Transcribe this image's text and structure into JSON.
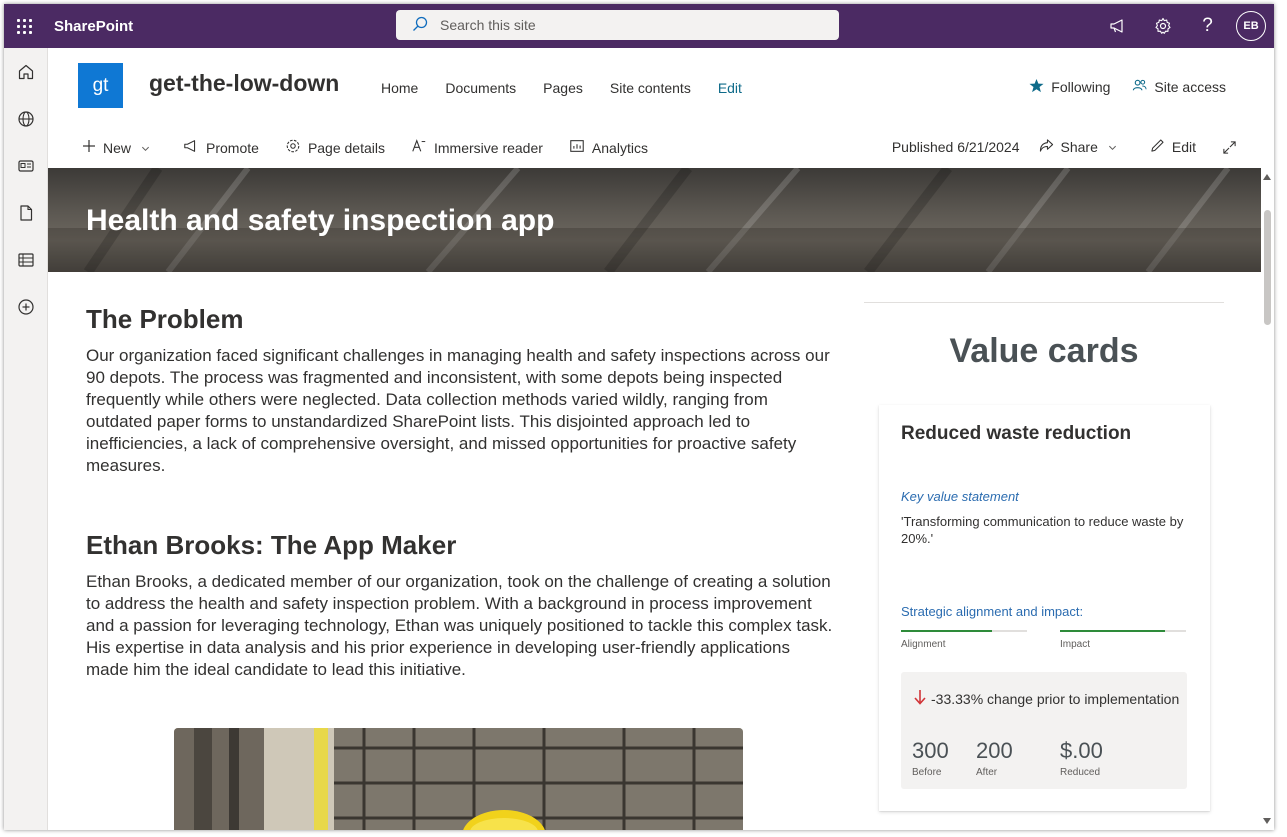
{
  "suitebar": {
    "brand": "SharePoint",
    "search_placeholder": "Search this site",
    "avatar_initials": "EB"
  },
  "site": {
    "logo_text": "gt",
    "title": "get-the-low-down",
    "nav": [
      "Home",
      "Documents",
      "Pages",
      "Site contents",
      "Edit"
    ],
    "following_label": "Following",
    "site_access_label": "Site access"
  },
  "commandbar": {
    "new_label": "New",
    "promote_label": "Promote",
    "page_details_label": "Page details",
    "immersive_reader_label": "Immersive reader",
    "analytics_label": "Analytics",
    "published_text": "Published 6/21/2024",
    "share_label": "Share",
    "edit_label": "Edit"
  },
  "banner": {
    "title": "Health and safety inspection app"
  },
  "content": {
    "section1_heading": "The Problem",
    "section1_text": "Our organization faced significant challenges in managing health and safety inspections across our 90 depots. The process was fragmented and inconsistent, with some depots being inspected frequently while others were neglected. Data collection methods varied wildly, ranging from outdated paper forms to unstandardized SharePoint lists. This disjointed approach led to inefficiencies, a lack of comprehensive oversight, and missed opportunities for proactive safety measures.",
    "section2_heading": "Ethan Brooks: The App Maker",
    "section2_text": "Ethan Brooks, a dedicated member of our organization, took on the challenge of creating a solution to address the health and safety inspection problem. With a background in process improvement and a passion for leveraging technology, Ethan was uniquely positioned to tackle this complex task. His expertise in data analysis and his prior experience in developing user-friendly applications made him the ideal candidate to lead this initiative."
  },
  "value_cards": {
    "heading": "Value cards",
    "card": {
      "title": "Reduced waste reduction",
      "key_value_label": "Key value statement",
      "key_value_text": "'Transforming communication to reduce waste by 20%.'",
      "strategic_label": "Strategic alignment and impact:",
      "alignment_label": "Alignment",
      "alignment_level": 0.72,
      "impact_label": "Impact",
      "impact_level": 0.83,
      "change_text": "-33.33% change prior to implementation",
      "before_value": "300",
      "before_label": "Before",
      "after_value": "200",
      "after_label": "After",
      "reduced_value": "$.00",
      "reduced_label": "Reduced"
    }
  },
  "colors": {
    "suitebar": "#4b2a63",
    "site_logo": "#0f78d4",
    "accent_link": "#0f6b8a",
    "meter_fill": "#2e8b3a",
    "down_arrow": "#d13438"
  },
  "icons": [
    "waffle-icon",
    "search-icon",
    "megaphone-icon",
    "gear-icon",
    "help-icon",
    "home-icon",
    "globe-icon",
    "news-icon",
    "page-icon",
    "list-icon",
    "plus-circle-icon",
    "star-icon",
    "people-icon",
    "plus-icon",
    "chevron-down-icon",
    "promote-icon",
    "settings-icon",
    "immersive-reader-icon",
    "analytics-icon",
    "share-icon",
    "pencil-icon",
    "expand-icon",
    "arrow-down-icon"
  ]
}
